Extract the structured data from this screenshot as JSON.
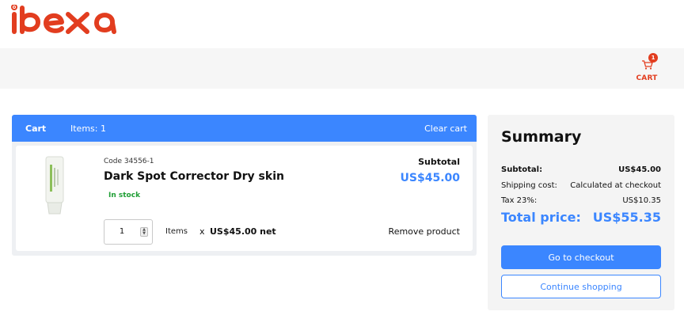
{
  "brand": {
    "logo_text": "ibexa",
    "accent": "#e23d1f",
    "primary": "#3b86ff",
    "success": "#1e9e34"
  },
  "header": {
    "cart_label": "CART",
    "cart_badge": "1",
    "cart_icon": "cart-icon"
  },
  "cart": {
    "tab_label": "Cart",
    "items_count": "Items: 1",
    "clear_label": "Clear cart",
    "product": {
      "code": "Code 34556-1",
      "name": "Dark Spot Corrector Dry skin",
      "stock": "In stock",
      "subtotal_label": "Subtotal",
      "subtotal_value": "US$45.00",
      "quantity": "1",
      "items_label": "Items",
      "times": "x",
      "unit_price": "US$45.00 net",
      "remove_label": "Remove product"
    }
  },
  "summary": {
    "title": "Summary",
    "subtotal_label": "Subtotal:",
    "subtotal_value": "US$45.00",
    "shipping_label": "Shipping cost:",
    "shipping_value": "Calculated at checkout",
    "tax_label": "Tax 23%:",
    "tax_value": "US$10.35",
    "total_label": "Total price:",
    "total_value": "US$55.35",
    "checkout_label": "Go to checkout",
    "continue_label": "Continue shopping"
  }
}
